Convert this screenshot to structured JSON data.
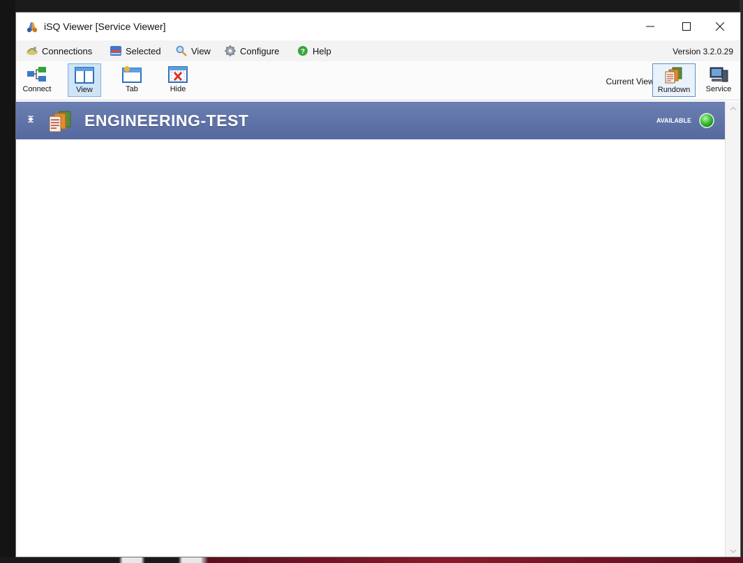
{
  "window": {
    "title": "iSQ Viewer [Service Viewer]",
    "accent": "#5569a0"
  },
  "menu": {
    "connections": "Connections",
    "selected": "Selected",
    "view": "View",
    "configure": "Configure",
    "help": "Help",
    "version": "Version 3.2.0.29"
  },
  "toolbar": {
    "connect": "Connect",
    "view": "View",
    "tab": "Tab",
    "hide": "Hide",
    "current_view_label": "Current View:",
    "rundown": "Rundown",
    "service": "Service"
  },
  "banner": {
    "title": "ENGINEERING-TEST",
    "status": "AVAILABLE",
    "status_color": "#3cc43c"
  },
  "icons": {
    "app": "binoculars-icon",
    "connections": "satellite-icon",
    "selected": "list-icon",
    "view": "magnifier-icon",
    "configure": "gear-icon",
    "help": "help-icon",
    "connect": "network-icon",
    "tab": "tab-icon",
    "hide": "hide-icon",
    "rundown": "rundown-icon",
    "service": "computer-icon"
  }
}
